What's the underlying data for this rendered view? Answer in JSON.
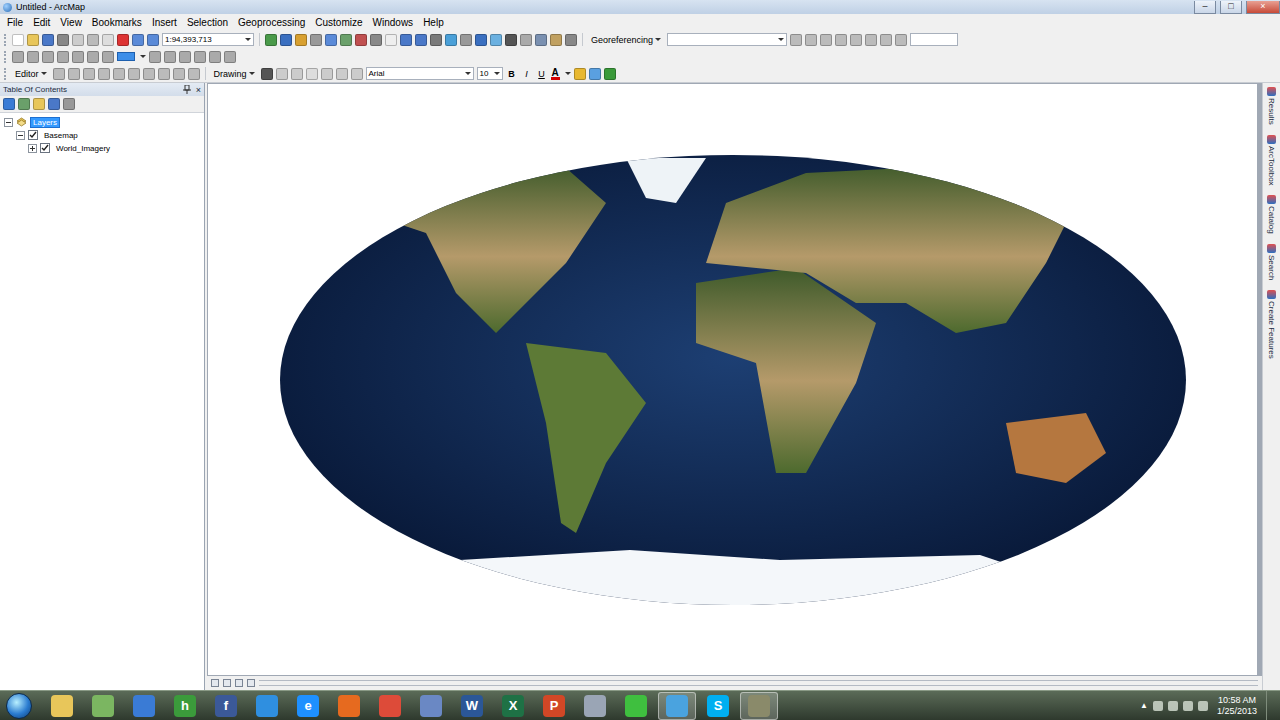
{
  "window": {
    "title": "Untitled - ArcMap",
    "controls": [
      "–",
      "□",
      "×"
    ]
  },
  "menu": [
    "File",
    "Edit",
    "View",
    "Bookmarks",
    "Insert",
    "Selection",
    "Geoprocessing",
    "Customize",
    "Windows",
    "Help"
  ],
  "toolbar": {
    "scale": "1:94,393,713",
    "georeferencing": "Georeferencing",
    "editor": "Editor",
    "drawing": "Drawing",
    "font": "Arial",
    "font_size": "10",
    "format_buttons": [
      "B",
      "I",
      "U"
    ],
    "text_color_label": "A"
  },
  "toc": {
    "title": "Table Of Contents",
    "close": "×",
    "layers": [
      {
        "name": "Layers",
        "depth": 0,
        "kind": "frame",
        "expanded": true,
        "checked": false,
        "selected": true
      },
      {
        "name": "Basemap",
        "depth": 1,
        "kind": "layer",
        "expanded": true,
        "checked": true,
        "selected": false
      },
      {
        "name": "World_Imagery",
        "depth": 2,
        "kind": "layer",
        "expanded": false,
        "checked": true,
        "selected": false
      }
    ]
  },
  "side_tabs": [
    {
      "label": "Results"
    },
    {
      "label": "ArcToolbox"
    },
    {
      "label": "Catalog"
    },
    {
      "label": "Search"
    },
    {
      "label": "Create Features"
    }
  ],
  "taskbar": {
    "apps": [
      {
        "glyph": "",
        "color": "#e8c65a",
        "active": false
      },
      {
        "glyph": "",
        "color": "#7bb661",
        "active": false
      },
      {
        "glyph": "",
        "color": "#3a7bd5",
        "active": false
      },
      {
        "glyph": "h",
        "color": "#3b9b3b",
        "active": false
      },
      {
        "glyph": "f",
        "color": "#3b5998",
        "active": false
      },
      {
        "glyph": "",
        "color": "#2f8fe0",
        "active": false
      },
      {
        "glyph": "e",
        "color": "#1e90ff",
        "active": false
      },
      {
        "glyph": "",
        "color": "#e66a1f",
        "active": false
      },
      {
        "glyph": "",
        "color": "#dd4b39",
        "active": false
      },
      {
        "glyph": "",
        "color": "#6a88c4",
        "active": false
      },
      {
        "glyph": "W",
        "color": "#2b5797",
        "active": false
      },
      {
        "glyph": "X",
        "color": "#1e7145",
        "active": false
      },
      {
        "glyph": "P",
        "color": "#d24726",
        "active": false
      },
      {
        "glyph": "",
        "color": "#9aa5b5",
        "active": false
      },
      {
        "glyph": "",
        "color": "#3fbf3f",
        "active": false
      },
      {
        "glyph": "",
        "color": "#4aa3df",
        "active": true
      },
      {
        "glyph": "S",
        "color": "#00aff0",
        "active": false
      },
      {
        "glyph": "",
        "color": "#8a8a6a",
        "active": true
      }
    ],
    "tray_expand": "▲",
    "time": "10:58 AM",
    "date": "1/25/2013"
  }
}
